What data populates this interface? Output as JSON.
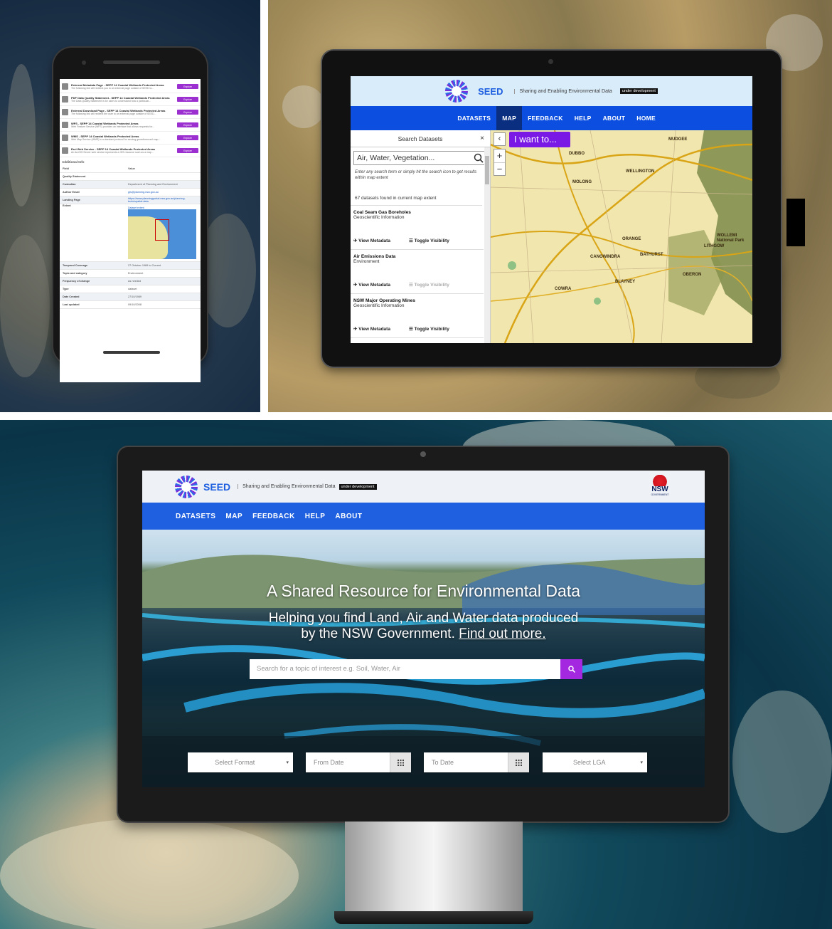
{
  "brand": {
    "name": "SEED",
    "tagline": "Sharing and Enabling Environmental Data",
    "badge": "under development",
    "gov_logo_text": "NSW",
    "gov_logo_sub": "GOVERNMENT"
  },
  "phone": {
    "downloads": [
      {
        "title": "External Metadata Page - SEPP 14 Coastal Wetlands Protected Areas",
        "desc": "The following link will redirect you to an external page outside of SEED to...",
        "action": "Explore"
      },
      {
        "title": "PDF Data Quality Statement - SEPP 14 Coastal Wetlands Protected Areas",
        "desc": "The Data Quality Statement is for users to understand how a particular...",
        "action": "Explore"
      },
      {
        "title": "External Download Page - SEPP 14 Coastal Wetlands Protected Areas",
        "desc": "The following link will redirect the user to an external page outside of SEED...",
        "action": "Explore"
      },
      {
        "title": "WFS - SEPP 14 Coastal Wetlands Protected Areas",
        "desc": "Web Feature Service (WFS) provides an interface that allows requests for...",
        "action": "Explore"
      },
      {
        "title": "WMS - SEPP 14 Coastal Wetlands Protected Areas",
        "desc": "Web Map Service (WMS) is a standard protocol for serving georeferenced map...",
        "action": "Explore"
      },
      {
        "title": "Esri Web Service - SEPP 14 Coastal Wetlands Protected Areas",
        "desc": "An ArcGIS Server web service represents a GIS resource such as a map...",
        "action": "Explore"
      }
    ],
    "additional_info_title": "Additional Info",
    "table_header": {
      "field": "Field",
      "value": "Value"
    },
    "rows": [
      {
        "field": "Quality Statement",
        "value": ""
      },
      {
        "field": "Custodian",
        "value": "Department of Planning and Environment"
      },
      {
        "field": "Author Email",
        "value": "gis@planning.nsw.gov.au"
      },
      {
        "field": "Landing Page",
        "value": "https://www.planningportal.nsw.gov.au/planning-tools/spatial-data"
      },
      {
        "field": "Extent",
        "value": "Dataset extent"
      },
      {
        "field": "Temporal Coverage",
        "value": "27 October 1989 to Current"
      },
      {
        "field": "Topic and category",
        "value": "Environment"
      },
      {
        "field": "Frequency of change",
        "value": "As needed"
      },
      {
        "field": "Type",
        "value": "dataset"
      },
      {
        "field": "Date Created",
        "value": "27/10/1989"
      },
      {
        "field": "Last updated",
        "value": "09/10/2008"
      }
    ]
  },
  "tablet": {
    "nav": [
      "DATASETS",
      "MAP",
      "FEEDBACK",
      "HELP",
      "ABOUT",
      "HOME"
    ],
    "active_nav": "MAP",
    "sidebar_title": "Search Datasets",
    "close_glyph": "×",
    "search_value": "Air, Water, Vegetation...",
    "hint": "Enter any search term or simply hit the search icon to get results within map extent",
    "count": "67 datasets found in current map extent",
    "datasets": [
      {
        "title": "Coal Seam Gas Boreholes",
        "category": "Geoscientific Information",
        "view": "View Metadata",
        "toggle": "Toggle Visibility",
        "toggle_enabled": true
      },
      {
        "title": "Air Emissions Data",
        "category": "Environment",
        "view": "View Metadata",
        "toggle": "Toggle Visibility",
        "toggle_enabled": false
      },
      {
        "title": "NSW Major Operating Mines",
        "category": "Geoscientific Information",
        "view": "View Metadata",
        "toggle": "Toggle Visibility",
        "toggle_enabled": true
      }
    ],
    "collapse_glyph": "‹",
    "i_want": "I want to...",
    "zoom_in": "+",
    "zoom_out": "−",
    "map_labels": [
      "DUBBO",
      "WELLINGTON",
      "MOLONG",
      "ORANGE",
      "BATHURST",
      "CANOWINDRA",
      "LITHGOW",
      "OBERON",
      "WOLLEMI National Park",
      "MUDGEE",
      "BLAYNEY",
      "COWRA"
    ]
  },
  "desktop": {
    "nav": [
      "DATASETS",
      "MAP",
      "FEEDBACK",
      "HELP",
      "ABOUT"
    ],
    "hero_title": "A Shared Resource for Environmental Data",
    "hero_sub_1": "Helping you find Land, Air and Water data produced",
    "hero_sub_2": "by the NSW Government.",
    "hero_link": "Find out more.",
    "search_placeholder": "Search for a topic of interest e.g. Soil, Water, Air",
    "filters": {
      "format": "Select Format",
      "from_date": "From Date",
      "to_date": "To Date",
      "lga": "Select LGA"
    }
  },
  "colors": {
    "primary_blue": "#1f60e0",
    "accent_purple": "#a428e0",
    "header_bg": "#eef2f7"
  }
}
